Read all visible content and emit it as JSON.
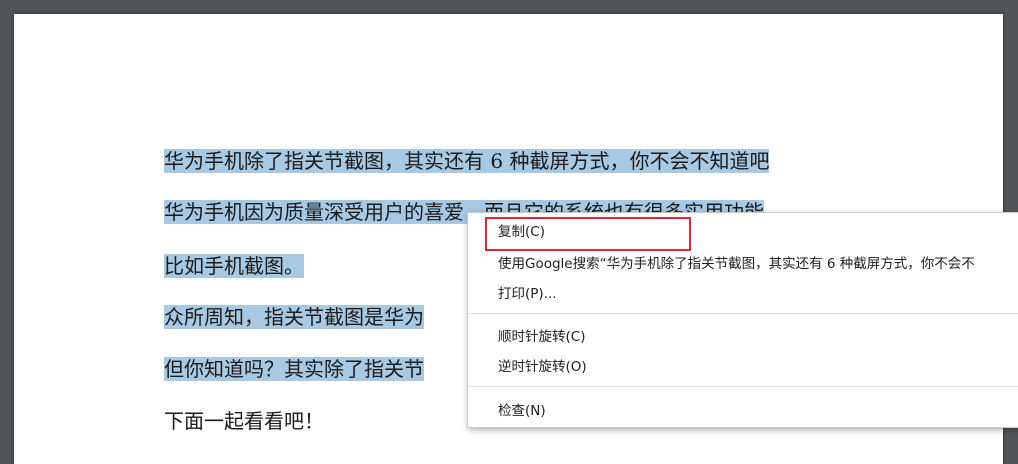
{
  "document": {
    "lines": [
      "华为手机除了指关节截图，其实还有 6 种截屏方式，你不会不知道吧",
      "华为手机因为质量深受用户的喜爱，而且它的系统也有很多实用功能",
      "比如手机截图。",
      "众所周知，指关节截图是华为",
      "但你知道吗？其实除了指关节",
      "下面一起看看吧！"
    ]
  },
  "context_menu": {
    "items": {
      "copy": "复制(C)",
      "google_search": "使用Google搜索“华为手机除了指关节截图，其实还有 6 种截屏方式，你不会不",
      "print": "打印(P)...",
      "rotate_cw": "顺时针旋转(C)",
      "rotate_ccw": "逆时针旋转(O)",
      "inspect": "检查(N)"
    }
  },
  "colors": {
    "selection": "#a8c9e4",
    "highlight_box": "#e0292d",
    "viewer_background": "#525659"
  }
}
